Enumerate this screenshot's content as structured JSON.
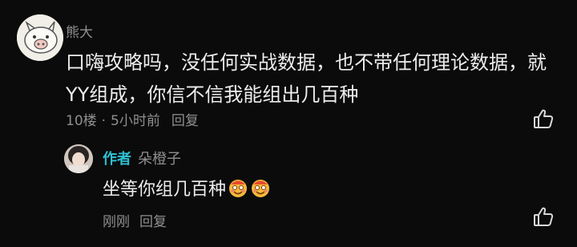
{
  "comment": {
    "username": "熊大",
    "text_line1": "口嗨攻略吗，没任何实战数据，也不带任何理论数据，就",
    "text_line2": "YY组成，你信不信我能组出几百种",
    "floor": "10楼",
    "separator": "·",
    "time": "5小时前",
    "reply_label": "回复",
    "avatar_icon": "pig-avatar-icon",
    "like_icon": "thumbs-up-icon"
  },
  "reply": {
    "author_badge": "作者",
    "username": "朵橙子",
    "text": "坐等你组几百种",
    "emoji_icon": "dizzy-smile-emoji-icon",
    "time": "刚刚",
    "reply_label": "回复",
    "like_icon": "thumbs-up-icon"
  },
  "colors": {
    "background": "#0b0b0b",
    "text": "#ededed",
    "muted": "#8f8f8f",
    "author_accent": "#2fc0d2"
  }
}
